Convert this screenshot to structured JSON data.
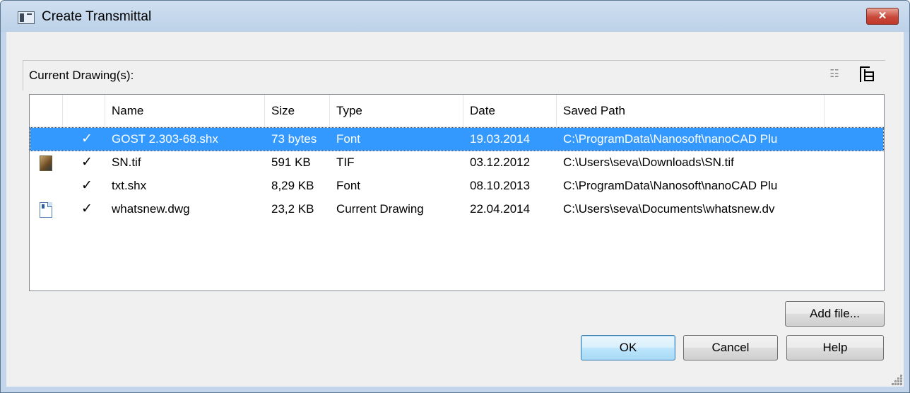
{
  "window": {
    "title": "Create Transmittal",
    "close_label": "✕"
  },
  "section": {
    "label": "Current Drawing(s):",
    "view_list_icon": "list-view-icon",
    "view_tree_icon": "tree-view-icon"
  },
  "table": {
    "columns": [
      "",
      "",
      "Name",
      "Size",
      "Type",
      "Date",
      "Saved Path"
    ],
    "rows": [
      {
        "icon": "none",
        "check": "✓",
        "name": "GOST 2.303-68.shx",
        "size": "73 bytes",
        "type": "Font",
        "date": "19.03.2014",
        "path": "C:\\ProgramData\\Nanosoft\\nanoCAD Plu",
        "selected": true
      },
      {
        "icon": "image-file-icon",
        "check": "✓",
        "name": "SN.tif",
        "size": "591 KB",
        "type": "TIF",
        "date": "03.12.2012",
        "path": "C:\\Users\\seva\\Downloads\\SN.tif",
        "selected": false
      },
      {
        "icon": "none",
        "check": "✓",
        "name": "txt.shx",
        "size": "8,29 KB",
        "type": "Font",
        "date": "08.10.2013",
        "path": "C:\\ProgramData\\Nanosoft\\nanoCAD Plu",
        "selected": false
      },
      {
        "icon": "drawing-file-icon",
        "check": "✓",
        "name": "whatsnew.dwg",
        "size": "23,2 KB",
        "type": "Current Drawing",
        "date": "22.04.2014",
        "path": "C:\\Users\\seva\\Documents\\whatsnew.dv",
        "selected": false
      }
    ]
  },
  "buttons": {
    "add_file": "Add file...",
    "ok": "OK",
    "cancel": "Cancel",
    "help": "Help"
  },
  "colors": {
    "selection": "#3399ff",
    "titlebar": "#c2d5eb",
    "close": "#c0392b"
  }
}
